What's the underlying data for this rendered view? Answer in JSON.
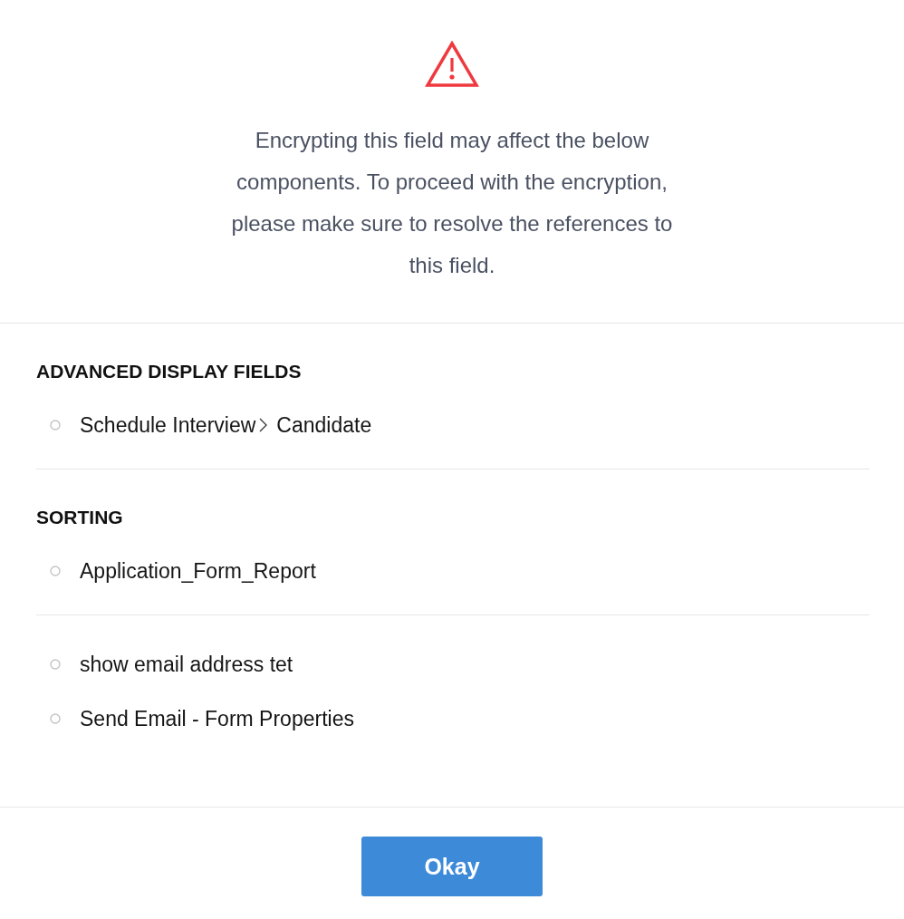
{
  "alert": {
    "message": "Encrypting this field may affect the below components. To proceed with the encryption, please make sure to resolve the references to this field."
  },
  "sections": [
    {
      "heading": "ADVANCED DISPLAY FIELDS",
      "items": [
        {
          "path": [
            "Schedule Interview",
            "Candidate"
          ]
        }
      ]
    },
    {
      "heading": "SORTING",
      "items": [
        {
          "path": [
            "Application_Form_Report"
          ]
        }
      ]
    },
    {
      "items": [
        {
          "path": [
            "show email address tet"
          ]
        },
        {
          "path": [
            "Send Email - Form Properties"
          ]
        }
      ]
    }
  ],
  "buttons": [
    {
      "label": "Okay"
    }
  ]
}
